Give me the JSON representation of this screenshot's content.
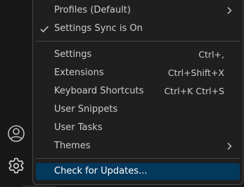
{
  "menu": {
    "items": [
      {
        "label": "Profiles (Default)",
        "shortcut": "",
        "checked": false,
        "submenu": true
      },
      {
        "label": "Settings Sync is On",
        "shortcut": "",
        "checked": true,
        "submenu": false
      },
      {
        "label": "Settings",
        "shortcut": "Ctrl+,",
        "checked": false,
        "submenu": false
      },
      {
        "label": "Extensions",
        "shortcut": "Ctrl+Shift+X",
        "checked": false,
        "submenu": false
      },
      {
        "label": "Keyboard Shortcuts",
        "shortcut": "Ctrl+K Ctrl+S",
        "checked": false,
        "submenu": false
      },
      {
        "label": "User Snippets",
        "shortcut": "",
        "checked": false,
        "submenu": false
      },
      {
        "label": "User Tasks",
        "shortcut": "",
        "checked": false,
        "submenu": false
      },
      {
        "label": "Themes",
        "shortcut": "",
        "checked": false,
        "submenu": true
      },
      {
        "label": "Check for Updates...",
        "shortcut": "",
        "checked": false,
        "submenu": false,
        "highlighted": true
      }
    ]
  },
  "activity_bar": {
    "icons": [
      "account-icon",
      "gear-icon"
    ]
  },
  "colors": {
    "menu_background": "#1f1f1f",
    "highlight": "#04395e",
    "text": "#cccccc",
    "separator": "#454545"
  }
}
